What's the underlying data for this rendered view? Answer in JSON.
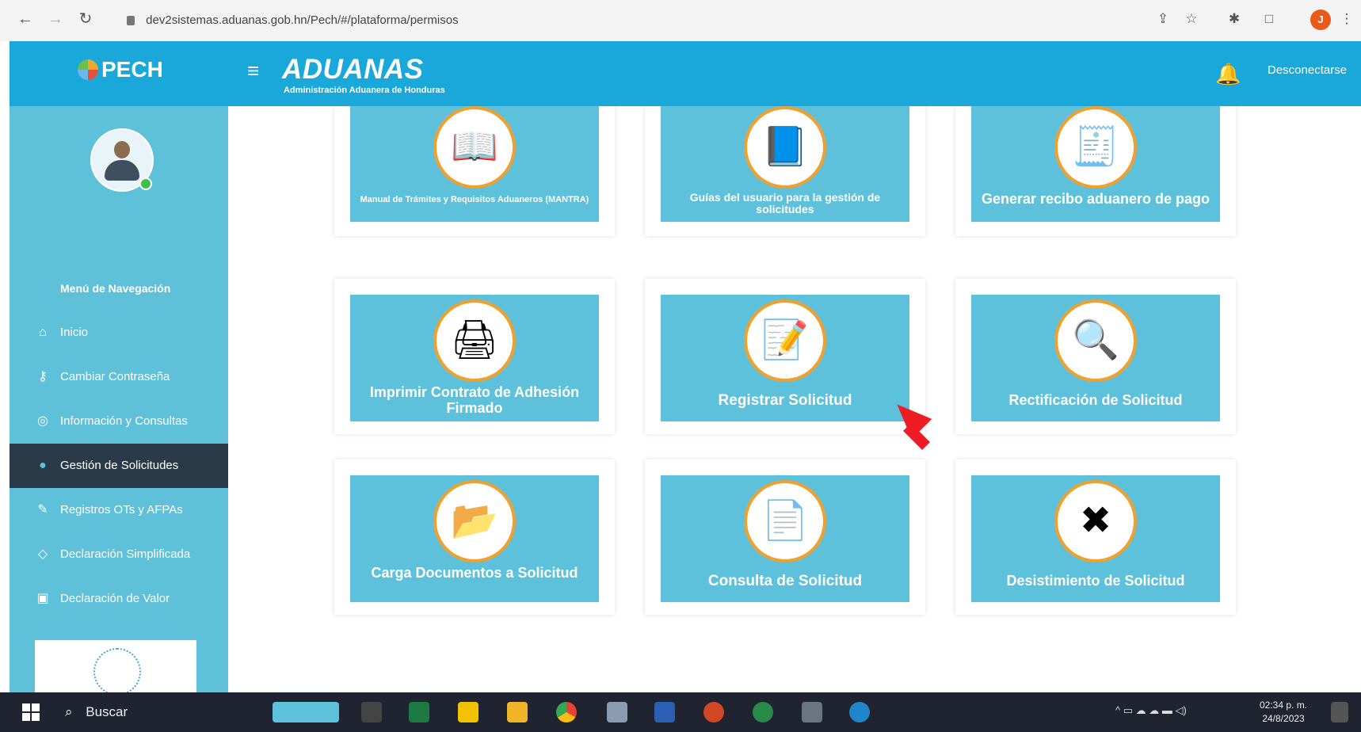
{
  "browser": {
    "url": "dev2sistemas.aduanas.gob.hn/Pech/#/plataforma/permisos",
    "profile_initial": "J"
  },
  "header": {
    "brand": "PECH",
    "logo_title": "ADUANAS",
    "logo_subtitle": "Administración Aduanera de Honduras",
    "logout": "Desconectarse"
  },
  "sidebar": {
    "menu_title": "Menú de Navegación",
    "items": [
      {
        "label": "Inicio",
        "icon": "home-icon"
      },
      {
        "label": "Cambiar Contraseña",
        "icon": "key-icon"
      },
      {
        "label": "Información y Consultas",
        "icon": "chat-icon"
      },
      {
        "label": "Gestión de Solicitudes",
        "icon": "globe-icon",
        "active": true
      },
      {
        "label": "Registros OTs y AFPAs",
        "icon": "edit-icon"
      },
      {
        "label": "Declaración Simplificada",
        "icon": "tag-icon"
      },
      {
        "label": "Declaración de Valor",
        "icon": "briefcase-icon"
      }
    ]
  },
  "tiles": [
    {
      "label": "Manual de Trámites y Requisitos Aduaneros (MANTRA)",
      "icon": "book-icon"
    },
    {
      "label": "Guías del usuario para la gestión de solicitudes",
      "icon": "user-guide-icon"
    },
    {
      "label": "Generar recibo aduanero de pago",
      "icon": "receipt-icon"
    },
    {
      "label": "Imprimir Contrato de Adhesión Firmado",
      "icon": "printer-icon"
    },
    {
      "label": "Registrar Solicitud",
      "icon": "form-pencil-icon"
    },
    {
      "label": "Rectificación de Solicitud",
      "icon": "document-search-icon"
    },
    {
      "label": "Carga Documentos a Solicitud",
      "icon": "folder-upload-icon"
    },
    {
      "label": "Consulta de Solicitud",
      "icon": "document-question-icon"
    },
    {
      "label": "Desistimiento de Solicitud",
      "icon": "check-cancel-icon"
    }
  ],
  "taskbar": {
    "search": "Buscar",
    "time": "02:34 p. m.",
    "date": "24/8/2023"
  },
  "colors": {
    "header": "#1aa7d9",
    "sidebar": "#5fc0d9",
    "tile": "#5ec1dc",
    "active_menu": "#2a3a48",
    "icon_ring": "#f0a02e",
    "cursor": "#ee1c25"
  }
}
